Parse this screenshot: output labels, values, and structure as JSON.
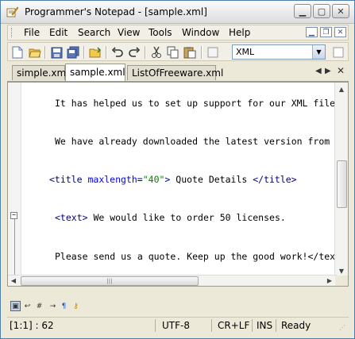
{
  "window": {
    "title": "Programmer's Notepad - [sample.xml]"
  },
  "menu": {
    "items": [
      "File",
      "Edit",
      "Search",
      "View",
      "Tools",
      "Window",
      "Help"
    ]
  },
  "toolbar": {
    "buttons": [
      "new-file-icon",
      "open-file-icon",
      "save-icon",
      "save-all-icon",
      "open-folder-icon",
      "undo-icon",
      "redo-icon",
      "cut-icon",
      "copy-icon",
      "paste-icon"
    ],
    "scheme_value": "XML"
  },
  "tabs": [
    {
      "label": "simple.xml",
      "active": false
    },
    {
      "label": "sample.xml",
      "active": true
    },
    {
      "label": "ListOfFreeware.xml",
      "active": false
    }
  ],
  "editor": {
    "lines": [
      {
        "text": "It has helped us to set up support for our XML file"
      },
      {
        "text": "We have already downloaded the latest version from"
      },
      {
        "tag_open": "<title ",
        "attr": "maxlength",
        "eq": "=",
        "value": "\"40\"",
        "close": ">",
        "content": " Quote Details ",
        "tag_end": "</title>"
      },
      {
        "tag_open": "<text>",
        "content": " We would like to order 50 licenses."
      },
      {
        "text": "Please send us a quote. Keep up the good work!</tex"
      }
    ]
  },
  "status": {
    "position": "[1:1] : 62",
    "encoding": "UTF-8",
    "line_ending": "CR+LF",
    "mode": "INS",
    "state": "Ready"
  }
}
